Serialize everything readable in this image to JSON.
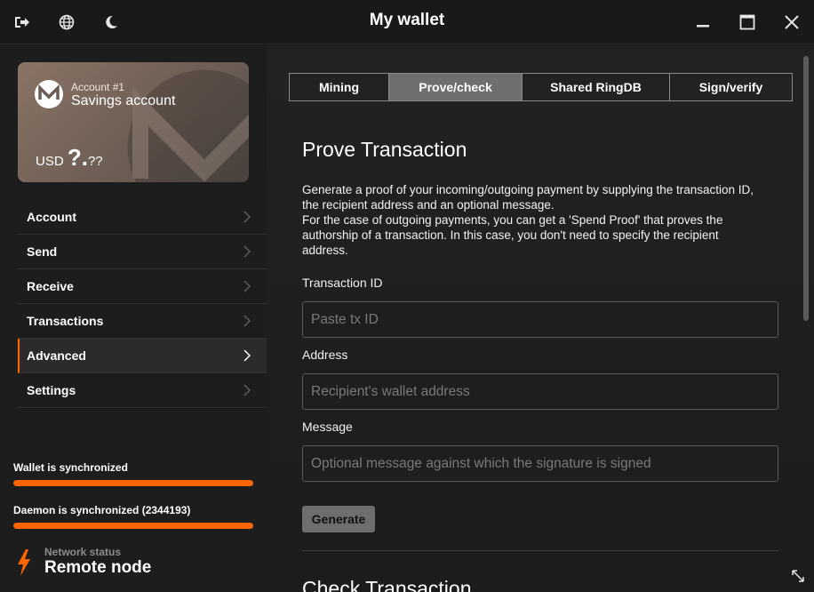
{
  "window": {
    "title": "My wallet"
  },
  "titlebar": {
    "left_icons": [
      "logout-icon",
      "globe-icon",
      "moon-icon"
    ],
    "right_icons": [
      "minimize-icon",
      "maximize-icon",
      "close-icon"
    ]
  },
  "account_card": {
    "account_label": "Account #1",
    "account_name": "Savings account",
    "currency": "USD",
    "balance_main": "?.",
    "balance_decimals": "??"
  },
  "menu": {
    "items": [
      {
        "label": "Account"
      },
      {
        "label": "Send"
      },
      {
        "label": "Receive"
      },
      {
        "label": "Transactions"
      },
      {
        "label": "Advanced"
      },
      {
        "label": "Settings"
      }
    ],
    "active": "Advanced"
  },
  "sync": {
    "wallet_label": "Wallet is synchronized",
    "wallet_progress": 1.0,
    "daemon_label": "Daemon is synchronized (2344193)",
    "daemon_progress": 1.0
  },
  "network": {
    "label": "Network status",
    "value": "Remote node"
  },
  "tabs": [
    {
      "label": "Mining"
    },
    {
      "label": "Prove/check"
    },
    {
      "label": "Shared RingDB"
    },
    {
      "label": "Sign/verify"
    }
  ],
  "active_tab": "Prove/check",
  "prove": {
    "title": "Prove Transaction",
    "description_lines": [
      "Generate a proof of your incoming/outgoing payment by supplying the transaction ID,",
      "the recipient address and an optional message.",
      "For the case of outgoing payments, you can get a 'Spend Proof' that proves the",
      "authorship of a transaction. In this case, you don't need to specify the recipient",
      "address."
    ],
    "txid_label": "Transaction ID",
    "txid_placeholder": "Paste tx ID",
    "txid_value": "",
    "address_label": "Address",
    "address_placeholder": "Recipient's wallet address",
    "address_value": "",
    "message_label": "Message",
    "message_placeholder": "Optional message against which the signature is signed",
    "message_value": "",
    "generate_label": "Generate"
  },
  "check": {
    "title": "Check Transaction"
  },
  "colors": {
    "accent": "#ff6600",
    "tab_active": "#6f6f6f",
    "background": "#1b1b1b"
  }
}
